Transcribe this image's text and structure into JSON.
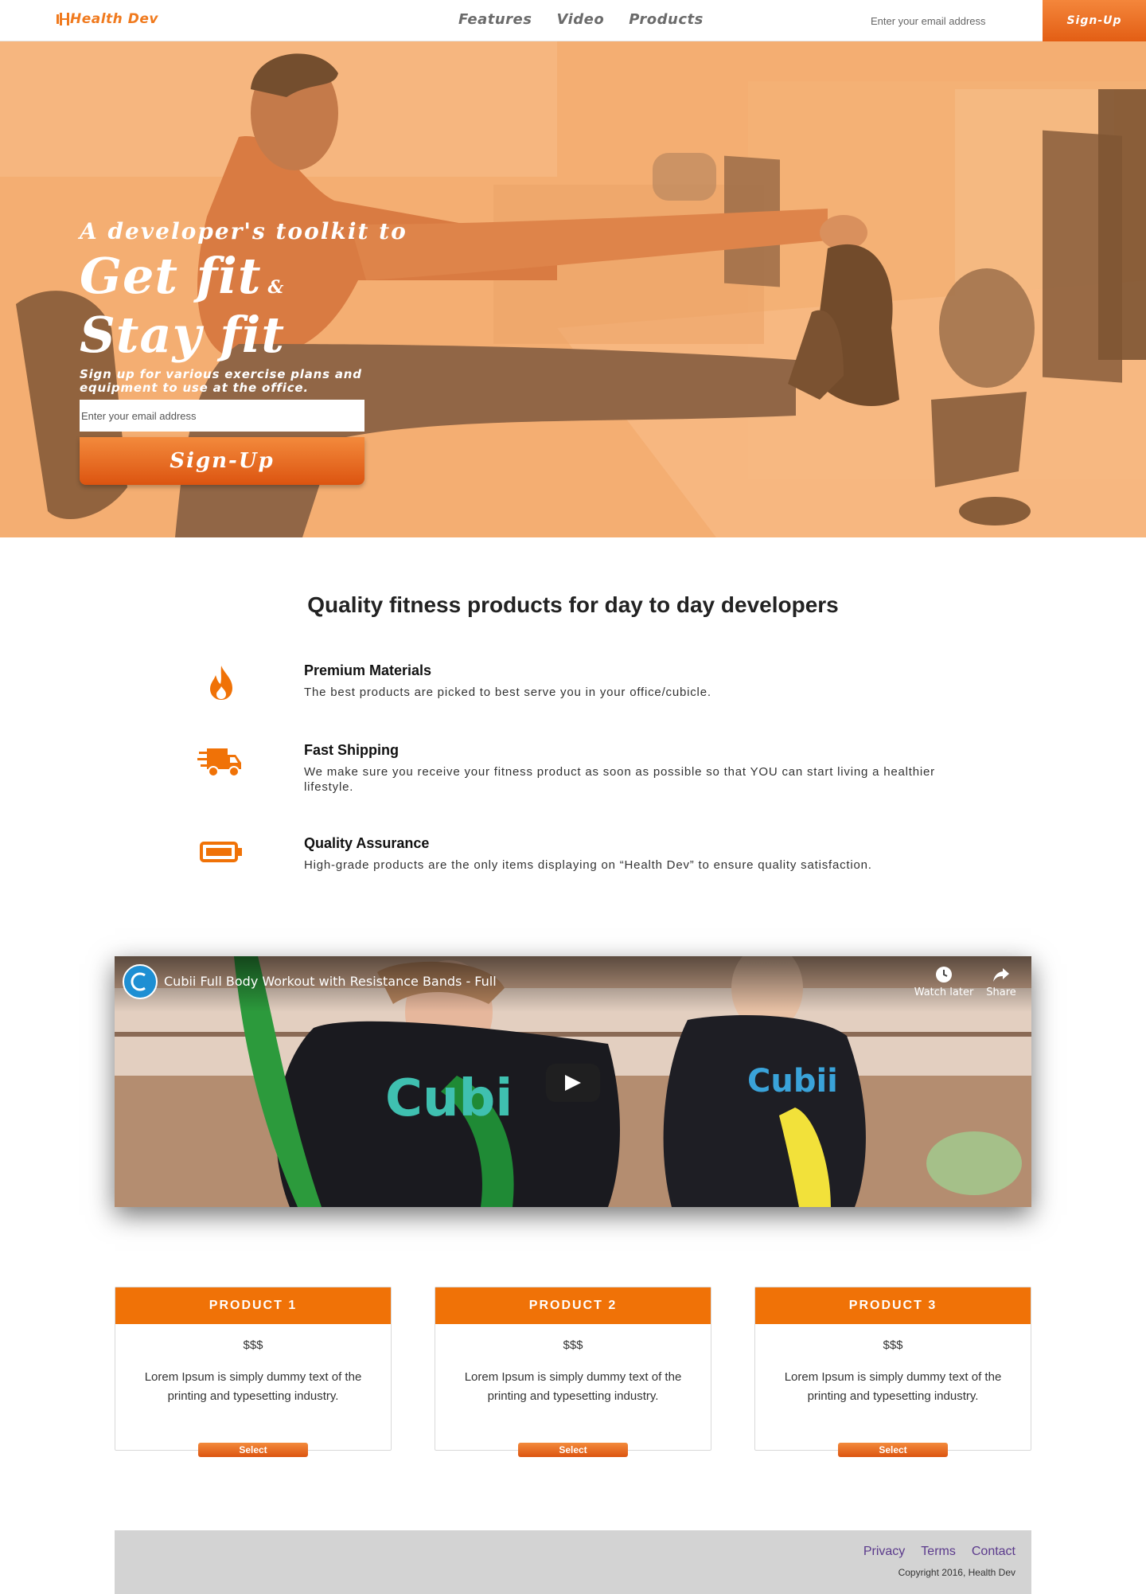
{
  "header": {
    "logo": "Health Dev",
    "nav": [
      "Features",
      "Video",
      "Products"
    ],
    "email_placeholder": "Enter your email address",
    "signup_label": "Sign-Up"
  },
  "hero": {
    "line1": "A developer's toolkit to",
    "line2": "Get fit",
    "amp": "&",
    "line3": "Stay fit",
    "subtitle": "Sign up for various exercise plans and equipment to use at the office.",
    "email_placeholder": "Enter your email address",
    "signup_label": "Sign-Up"
  },
  "features": {
    "title": "Quality fitness products for day to day developers",
    "items": [
      {
        "icon": "fire-icon",
        "title": "Premium Materials",
        "desc": "The best products are picked to best serve you in your office/cubicle."
      },
      {
        "icon": "shipping-truck-icon",
        "title": "Fast Shipping",
        "desc": "We make sure you receive your fitness product as soon as possible so that YOU can start living a healthier lifestyle."
      },
      {
        "icon": "battery-icon",
        "title": "Quality Assurance",
        "desc": "High-grade products are the only items displaying on “Health Dev” to ensure quality satisfaction."
      }
    ]
  },
  "video": {
    "title": "Cubii Full Body Workout with Resistance Bands - Full",
    "watch_later": "Watch later",
    "share": "Share"
  },
  "products": [
    {
      "name": "PRODUCT 1",
      "price": "$$$",
      "desc": "Lorem Ipsum is simply dummy text of the printing and typesetting industry.",
      "button": "Select"
    },
    {
      "name": "PRODUCT 2",
      "price": "$$$",
      "desc": "Lorem Ipsum is simply dummy text of the printing and typesetting industry.",
      "button": "Select"
    },
    {
      "name": "PRODUCT 3",
      "price": "$$$",
      "desc": "Lorem Ipsum is simply dummy text of the printing and typesetting industry.",
      "button": "Select"
    }
  ],
  "footer": {
    "links": [
      "Privacy",
      "Terms",
      "Contact"
    ],
    "copyright": "Copyright 2016, Health Dev"
  },
  "colors": {
    "accent": "#f07207",
    "hero_tint": "#f2ae75",
    "footer_bg": "#d3d3d3",
    "link": "#5b3a8c"
  }
}
